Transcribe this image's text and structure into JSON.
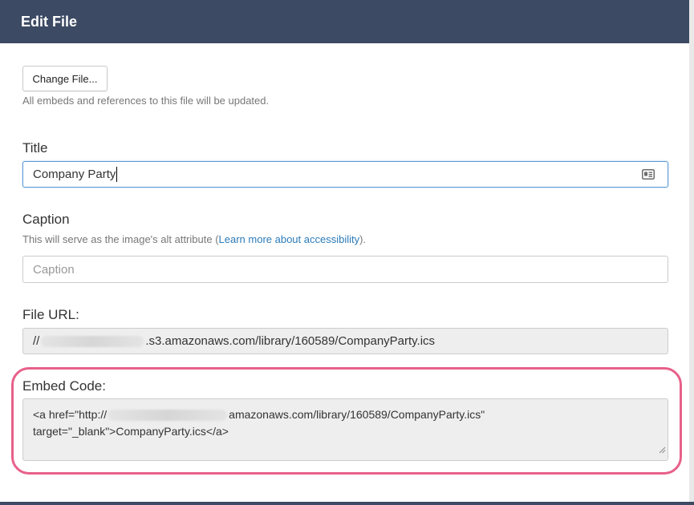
{
  "header": {
    "title": "Edit File"
  },
  "change_file": {
    "button_label": "Change File...",
    "help": "All embeds and references to this file will be updated."
  },
  "title_field": {
    "label": "Title",
    "value": "Company Party"
  },
  "caption_field": {
    "label": "Caption",
    "help_prefix": "This will serve as the image's alt attribute (",
    "help_link": "Learn more about accessibility",
    "help_suffix": ").",
    "placeholder": "Caption"
  },
  "file_url": {
    "label": "File URL:",
    "prefix": "//",
    "suffix": ".s3.amazonaws.com/library/160589/CompanyParty.ics"
  },
  "embed_code": {
    "label": "Embed Code:",
    "line1_prefix": "<a href=\"http://",
    "line1_suffix": "amazonaws.com/library/160589/CompanyParty.ics\"",
    "line2": "target=\"_blank\">CompanyParty.ics</a>"
  },
  "icons": {
    "title_field_icon": "contact-card-icon",
    "resize": "resize-grip-icon"
  },
  "colors": {
    "header_bg": "#3c4a63",
    "highlight": "#e8608a",
    "link": "#2b7bb9",
    "focus": "#5b9bd5"
  }
}
